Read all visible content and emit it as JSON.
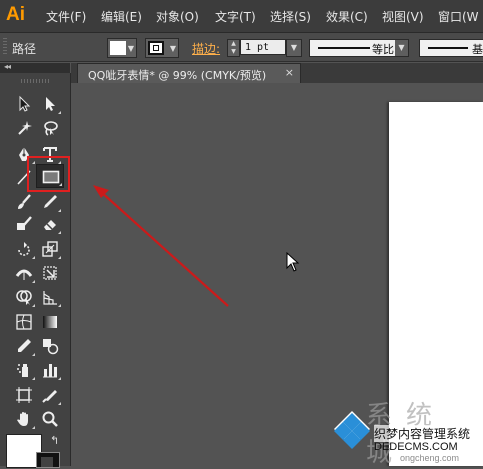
{
  "app": {
    "logo": "Ai"
  },
  "menu": {
    "items": [
      "文件(F)",
      "编辑(E)",
      "对象(O)",
      "文字(T)",
      "选择(S)",
      "效果(C)",
      "视图(V)",
      "窗口(W"
    ]
  },
  "control_bar": {
    "selection_label": "路径",
    "fill_color": "#ffffff",
    "stroke_label": "描边:",
    "stroke_weight": "1 pt",
    "profile_label": "等比",
    "brush_label": "基"
  },
  "document": {
    "tab_title": "QQ呲牙表情* @ 99% (CMYK/预览)",
    "close_glyph": "×"
  },
  "tools": {
    "collapse_glyph": "◂◂",
    "swap_glyph": "↰",
    "highlight_color": "#e02020",
    "highlighted_tool": "rectangle-tool",
    "items": [
      {
        "name": "selection-tool-icon"
      },
      {
        "name": "direct-selection-tool-icon"
      },
      {
        "name": "magic-wand-tool-icon"
      },
      {
        "name": "lasso-tool-icon"
      },
      {
        "name": "pen-tool-icon"
      },
      {
        "name": "type-tool-icon"
      },
      {
        "name": "line-segment-tool-icon"
      },
      {
        "name": "rectangle-tool-icon"
      },
      {
        "name": "paintbrush-tool-icon"
      },
      {
        "name": "pencil-tool-icon"
      },
      {
        "name": "blob-brush-tool-icon"
      },
      {
        "name": "eraser-tool-icon"
      },
      {
        "name": "rotate-tool-icon"
      },
      {
        "name": "scale-tool-icon"
      },
      {
        "name": "width-tool-icon"
      },
      {
        "name": "free-transform-tool-icon"
      },
      {
        "name": "shape-builder-tool-icon"
      },
      {
        "name": "perspective-grid-tool-icon"
      },
      {
        "name": "mesh-tool-icon"
      },
      {
        "name": "gradient-tool-icon"
      },
      {
        "name": "eyedropper-tool-icon"
      },
      {
        "name": "blend-tool-icon"
      },
      {
        "name": "symbol-sprayer-tool-icon"
      },
      {
        "name": "column-graph-tool-icon"
      },
      {
        "name": "artboard-tool-icon"
      },
      {
        "name": "slice-tool-icon"
      },
      {
        "name": "hand-tool-icon"
      },
      {
        "name": "zoom-tool-icon"
      }
    ]
  },
  "annotation": {
    "arrow_color": "#cc1a1a"
  },
  "watermark": {
    "big_text": "系统城",
    "line1": "织梦内容管理系统",
    "line2": "DEDECMS.COM",
    "line3": "ongcheng.com"
  }
}
